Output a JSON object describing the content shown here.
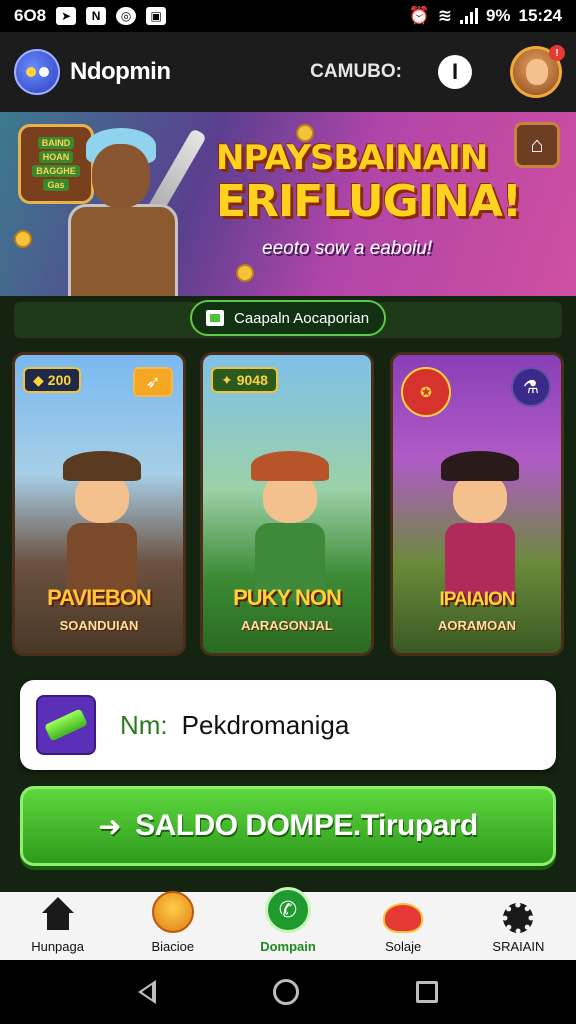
{
  "status_bar": {
    "left_text": "6O8",
    "battery": "9%",
    "time": "15:24",
    "notification_icons": [
      "cursor-icon",
      "n-icon",
      "circle-icon",
      "image-icon"
    ]
  },
  "header": {
    "app_name": "Ndopmin",
    "campaign_label": "CAMUBO:",
    "info_icon": "I"
  },
  "banner": {
    "title_line1": "NPAYSBAINAIN",
    "title_line2": "ERIFLUGINA!",
    "subtitle": "eeoto sow a eaboiu!",
    "medal_lines": [
      "BAIND",
      "HOAN",
      "BAGGHE",
      "Gas"
    ]
  },
  "campaign_pill": {
    "label": "Caapaln Aocaporian"
  },
  "cards": [
    {
      "tag": "200",
      "name": "PAVIEBON",
      "subname": "SOANDUIAN",
      "tag_icon": "arrow-icon"
    },
    {
      "tag": "9048",
      "name": "PUKY NON",
      "subname": "AARAGONJAL",
      "tag_icon": ""
    },
    {
      "tag": "",
      "name": "IPAIAION",
      "subname": "AORAMOAN",
      "tag_icon": "potion-icon"
    }
  ],
  "input": {
    "label": "Nm:",
    "value": "Pekdromaniga"
  },
  "main_button": {
    "label": "SALDO DOMPE.Tirupard"
  },
  "bottom_nav": [
    {
      "label": "Hunpaga",
      "icon": "home-icon"
    },
    {
      "label": "Biacioe",
      "icon": "bowl-icon"
    },
    {
      "label": "Dompain",
      "icon": "phone-icon",
      "active": true
    },
    {
      "label": "Solaje",
      "icon": "cake-icon"
    },
    {
      "label": "SRAIAIN",
      "icon": "gear-icon"
    }
  ],
  "colors": {
    "accent_green": "#4cc238",
    "banner_title": "#ffd21f",
    "background": "#142410"
  }
}
